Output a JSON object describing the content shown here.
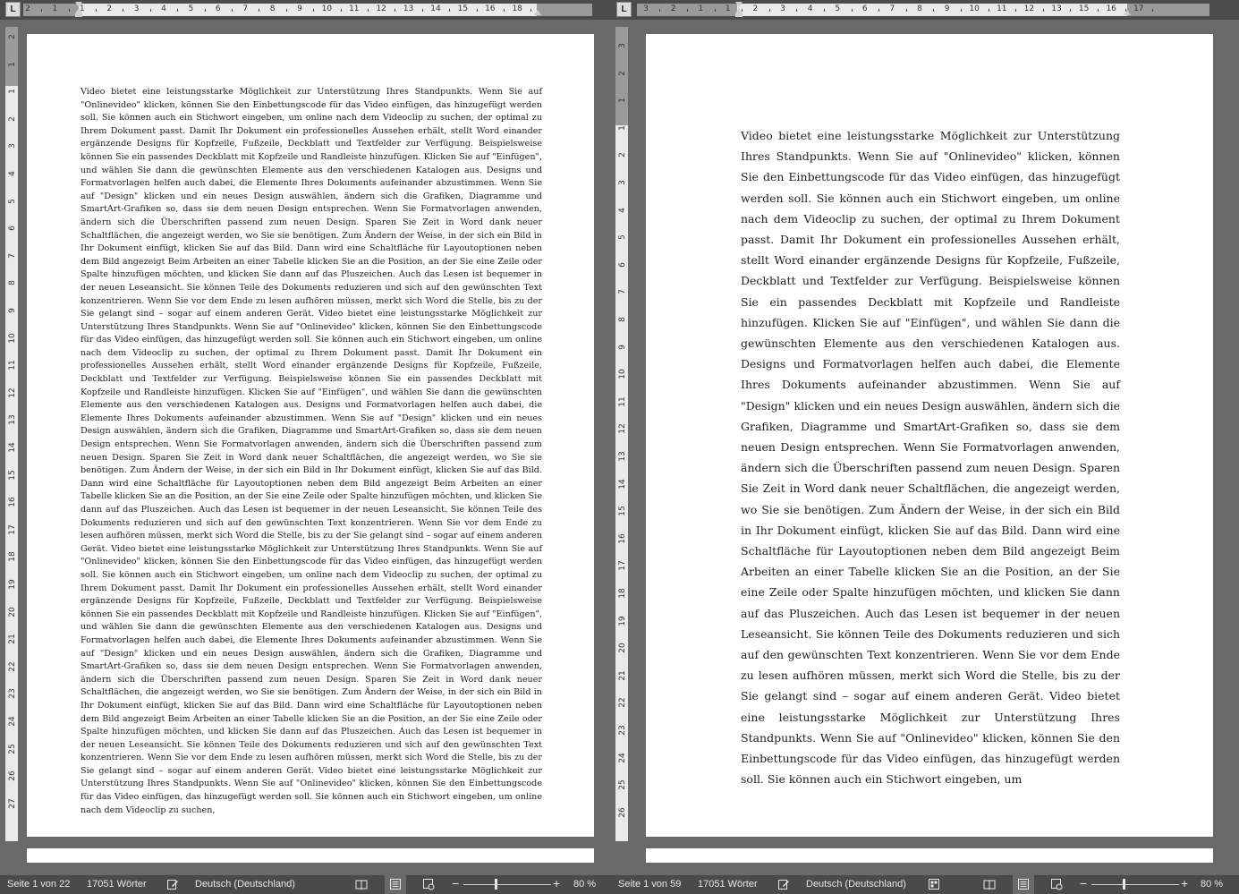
{
  "app": {
    "accent": "#4a4a4a"
  },
  "left_window": {
    "ruler": {
      "tab_selector": "L",
      "numbers": [
        "2",
        "1",
        "1",
        "2",
        "3",
        "4",
        "5",
        "6",
        "7",
        "8",
        "9",
        "10",
        "11",
        "12",
        "13",
        "14",
        "15",
        "16",
        "18"
      ],
      "vertical_numbers": [
        "2",
        "1",
        "1",
        "2",
        "3",
        "4",
        "5",
        "6",
        "7",
        "8",
        "9",
        "10",
        "11",
        "12",
        "13",
        "14",
        "15",
        "16",
        "17",
        "18",
        "19",
        "20",
        "21",
        "22",
        "23",
        "24",
        "25",
        "26",
        "27"
      ]
    },
    "document_text": "Video bietet eine leistungsstarke Möglichkeit zur Unterstützung Ihres Standpunkts. Wenn Sie auf \"Onlinevideo\" klicken, können Sie den Einbettungscode für das Video einfügen, das hinzugefügt werden soll. Sie können auch ein Stichwort eingeben, um online nach dem Videoclip zu suchen, der optimal zu Ihrem Dokument passt. Damit Ihr Dokument ein professionelles Aussehen erhält, stellt Word einander ergänzende Designs für Kopfzeile, Fußzeile, Deckblatt und Textfelder zur Verfügung. Beispielsweise können Sie ein passendes Deckblatt mit Kopfzeile und Randleiste hinzufügen. Klicken Sie auf \"Einfügen\", und wählen Sie dann die gewünschten Elemente aus den verschiedenen Katalogen aus. Designs und Formatvorlagen helfen auch dabei, die Elemente Ihres Dokuments aufeinander abzustimmen. Wenn Sie auf \"Design\" klicken und ein neues Design auswählen, ändern sich die Grafiken, Diagramme und SmartArt-Grafiken so, dass sie dem neuen Design entsprechen. Wenn Sie Formatvorlagen anwenden, ändern sich die Überschriften passend zum neuen Design. Sparen Sie Zeit in Word dank neuer Schaltflächen, die angezeigt werden, wo Sie sie benötigen. Zum Ändern der Weise, in der sich ein Bild in Ihr Dokument einfügt, klicken Sie auf das Bild. Dann wird eine Schaltfläche für Layoutoptionen neben dem Bild angezeigt Beim Arbeiten an einer Tabelle klicken Sie an die Position, an der Sie eine Zeile oder Spalte hinzufügen möchten, und klicken Sie dann auf das Pluszeichen. Auch das Lesen ist bequemer in der neuen Leseansicht. Sie können Teile des Dokuments reduzieren und sich auf den gewünschten Text konzentrieren. Wenn Sie vor dem Ende zu lesen aufhören müssen, merkt sich Word die Stelle, bis zu der Sie gelangt sind – sogar auf einem anderen Gerät. Video bietet eine leistungsstarke Möglichkeit zur Unterstützung Ihres Standpunkts. Wenn Sie auf \"Onlinevideo\" klicken, können Sie den Einbettungscode für das Video einfügen, das hinzugefügt werden soll. Sie können auch ein Stichwort eingeben, um online nach dem Videoclip zu suchen, der optimal zu Ihrem Dokument passt. Damit Ihr Dokument ein professionelles Aussehen erhält, stellt Word einander ergänzende Designs für Kopfzeile, Fußzeile, Deckblatt und Textfelder zur Verfügung. Beispielsweise können Sie ein passendes Deckblatt mit Kopfzeile und Randleiste hinzufügen. Klicken Sie auf \"Einfügen\", und wählen Sie dann die gewünschten Elemente aus den verschiedenen Katalogen aus. Designs und Formatvorlagen helfen auch dabei, die Elemente Ihres Dokuments aufeinander abzustimmen. Wenn Sie auf \"Design\" klicken und ein neues Design auswählen, ändern sich die Grafiken, Diagramme und SmartArt-Grafiken so, dass sie dem neuen Design entsprechen. Wenn Sie Formatvorlagen anwenden, ändern sich die Überschriften passend zum neuen Design. Sparen Sie Zeit in Word dank neuer Schaltflächen, die angezeigt werden, wo Sie sie benötigen. Zum Ändern der Weise, in der sich ein Bild in Ihr Dokument einfügt, klicken Sie auf das Bild. Dann wird eine Schaltfläche für Layoutoptionen neben dem Bild angezeigt Beim Arbeiten an einer Tabelle klicken Sie an die Position, an der Sie eine Zeile oder Spalte hinzufügen möchten, und klicken Sie dann auf das Pluszeichen. Auch das Lesen ist bequemer in der neuen Leseansicht. Sie können Teile des Dokuments reduzieren und sich auf den gewünschten Text konzentrieren. Wenn Sie vor dem Ende zu lesen aufhören müssen, merkt sich Word die Stelle, bis zu der Sie gelangt sind – sogar auf einem anderen Gerät. Video bietet eine leistungsstarke Möglichkeit zur Unterstützung Ihres Standpunkts. Wenn Sie auf \"Onlinevideo\" klicken, können Sie den Einbettungscode für das Video einfügen, das hinzugefügt werden soll. Sie können auch ein Stichwort eingeben, um online nach dem Videoclip zu suchen, der optimal zu Ihrem Dokument passt. Damit Ihr Dokument ein professionelles Aussehen erhält, stellt Word einander ergänzende Designs für Kopfzeile, Fußzeile, Deckblatt und Textfelder zur Verfügung. Beispielsweise können Sie ein passendes Deckblatt mit Kopfzeile und Randleiste hinzufügen. Klicken Sie auf \"Einfügen\", und wählen Sie dann die gewünschten Elemente aus den verschiedenen Katalogen aus. Designs und Formatvorlagen helfen auch dabei, die Elemente Ihres Dokuments aufeinander abzustimmen. Wenn Sie auf \"Design\" klicken und ein neues Design auswählen, ändern sich die Grafiken, Diagramme und SmartArt-Grafiken so, dass sie dem neuen Design entsprechen. Wenn Sie Formatvorlagen anwenden, ändern sich die Überschriften passend zum neuen Design. Sparen Sie Zeit in Word dank neuer Schaltflächen, die angezeigt werden, wo Sie sie benötigen. Zum Ändern der Weise, in der sich ein Bild in Ihr Dokument einfügt, klicken Sie auf das Bild. Dann wird eine Schaltfläche für Layoutoptionen neben dem Bild angezeigt Beim Arbeiten an einer Tabelle klicken Sie an die Position, an der Sie eine Zeile oder Spalte hinzufügen möchten, und klicken Sie dann auf das Pluszeichen. Auch das Lesen ist bequemer in der neuen Leseansicht. Sie können Teile des Dokuments reduzieren und sich auf den gewünschten Text konzentrieren. Wenn Sie vor dem Ende zu lesen aufhören müssen, merkt sich Word die Stelle, bis zu der Sie gelangt sind – sogar auf einem anderen Gerät. Video bietet eine leistungsstarke Möglichkeit zur Unterstützung Ihres Standpunkts. Wenn Sie auf \"Onlinevideo\" klicken, können Sie den Einbettungscode für das Video einfügen, das hinzugefügt werden soll. Sie können auch ein Stichwort eingeben, um online nach dem Videoclip zu suchen,",
    "status": {
      "page": "Seite 1 von 22",
      "words": "17051 Wörter",
      "language": "Deutsch (Deutschland)",
      "zoom": "80 %"
    }
  },
  "right_window": {
    "ruler": {
      "tab_selector": "L",
      "numbers": [
        "3",
        "2",
        "1",
        "1",
        "2",
        "3",
        "4",
        "5",
        "6",
        "7",
        "8",
        "9",
        "10",
        "11",
        "12",
        "13",
        "15",
        "16",
        "17"
      ],
      "vertical_numbers": [
        "3",
        "2",
        "1",
        "1",
        "2",
        "3",
        "4",
        "5",
        "6",
        "7",
        "8",
        "9",
        "10",
        "11",
        "12",
        "13",
        "14",
        "15",
        "16",
        "17",
        "18",
        "19",
        "20",
        "21",
        "22",
        "23",
        "24",
        "25",
        "26"
      ]
    },
    "document_text": "Video bietet eine leistungsstarke Möglichkeit zur Unterstützung Ihres Standpunkts. Wenn Sie auf \"Onlinevideo\" klicken, können Sie den Einbettungscode für das Video einfügen, das hinzugefügt werden soll. Sie können auch ein Stichwort eingeben, um online nach dem Videoclip zu suchen, der optimal zu Ihrem Dokument passt. Damit Ihr Dokument ein professionelles Aussehen erhält, stellt Word einander ergänzende Designs für Kopfzeile, Fußzeile, Deckblatt und Textfelder zur Verfügung. Beispielsweise können Sie ein passendes Deckblatt mit Kopfzeile und Randleiste hinzufügen. Klicken Sie auf \"Einfügen\", und wählen Sie dann die gewünschten Elemente aus den verschiedenen Katalogen aus. Designs und Formatvorlagen helfen auch dabei, die Elemente Ihres Dokuments aufeinander abzustimmen. Wenn Sie auf \"Design\" klicken und ein neues Design auswählen, ändern sich die Grafiken, Diagramme und SmartArt-Grafiken so, dass sie dem neuen Design entsprechen. Wenn Sie Formatvorlagen anwenden, ändern sich die Überschriften passend zum neuen Design. Sparen Sie Zeit in Word dank neuer Schaltflächen, die angezeigt werden, wo Sie sie benötigen. Zum Ändern der Weise, in der sich ein Bild in Ihr Dokument einfügt, klicken Sie auf das Bild. Dann wird eine Schaltfläche für Layoutoptionen neben dem Bild angezeigt Beim Arbeiten an einer Tabelle klicken Sie an die Position, an der Sie eine Zeile oder Spalte hinzufügen möchten, und klicken Sie dann auf das Pluszeichen. Auch das Lesen ist bequemer in der neuen Leseansicht. Sie können Teile des Dokuments reduzieren und sich auf den gewünschten Text konzentrieren. Wenn Sie vor dem Ende zu lesen aufhören müssen, merkt sich Word die Stelle, bis zu der Sie gelangt sind – sogar auf einem anderen Gerät. Video bietet eine leistungsstarke Möglichkeit zur Unterstützung Ihres Standpunkts. Wenn Sie auf \"Onlinevideo\" klicken, können Sie den Einbettungscode für das Video einfügen, das hinzugefügt werden soll. Sie können auch ein Stichwort eingeben, um",
    "status": {
      "page": "Seite 1 von 59",
      "words": "17051 Wörter",
      "language": "Deutsch (Deutschland)",
      "zoom": "80 %"
    }
  },
  "icons": {
    "proofing": "proofing-book-icon",
    "macro": "macro-record-icon",
    "read_mode": "read-mode-icon",
    "print_layout": "print-layout-icon",
    "web_layout": "web-layout-icon",
    "zoom_out": "−",
    "zoom_in": "+"
  }
}
